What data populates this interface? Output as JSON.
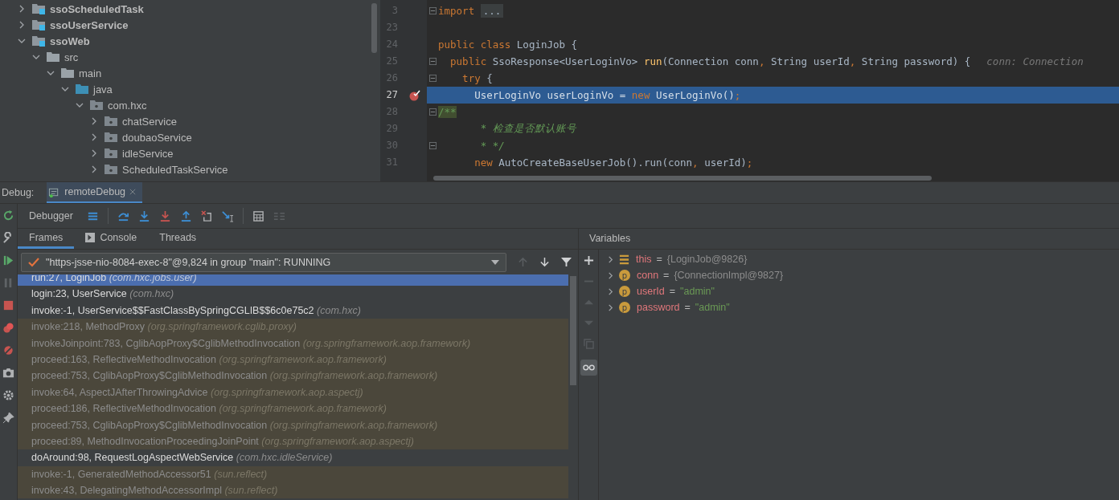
{
  "project_tree": [
    {
      "label": "ssoScheduledTask",
      "kind": "module",
      "expanded": false
    },
    {
      "label": "ssoUserService",
      "kind": "module",
      "expanded": false
    },
    {
      "label": "ssoWeb",
      "kind": "module",
      "expanded": true,
      "children": [
        {
          "label": "src",
          "kind": "folder",
          "expanded": true,
          "children": [
            {
              "label": "main",
              "kind": "folder",
              "expanded": true,
              "children": [
                {
                  "label": "java",
                  "kind": "source",
                  "expanded": true,
                  "children": [
                    {
                      "label": "com.hxc",
                      "kind": "package",
                      "expanded": true,
                      "children": [
                        {
                          "label": "chatService",
                          "kind": "package",
                          "expanded": false
                        },
                        {
                          "label": "doubaoService",
                          "kind": "package",
                          "expanded": false
                        },
                        {
                          "label": "idleService",
                          "kind": "package",
                          "expanded": false
                        },
                        {
                          "label": "ScheduledTaskService",
                          "kind": "package",
                          "expanded": false
                        }
                      ]
                    }
                  ]
                }
              ]
            }
          ]
        }
      ]
    }
  ],
  "editor": {
    "lines": [
      {
        "number": "3",
        "selected": false,
        "breakpoint": false,
        "fold": true,
        "tokens": [
          {
            "kind": "kw",
            "s": "import "
          },
          {
            "kind": "folded",
            "s": "..."
          }
        ]
      },
      {
        "number": "23",
        "selected": false,
        "breakpoint": false,
        "fold": false
      },
      {
        "number": "24",
        "selected": false,
        "breakpoint": false,
        "fold": false,
        "tokens": [
          {
            "kind": "kw",
            "s": "public class "
          },
          {
            "kind": "plain",
            "s": "LoginJob {"
          }
        ]
      },
      {
        "number": "25",
        "selected": false,
        "breakpoint": false,
        "fold": true,
        "tokens": [
          {
            "kind": "kw",
            "s": "  public "
          },
          {
            "kind": "plain",
            "s": "SsoResponse<UserLoginVo> "
          },
          {
            "kind": "method",
            "s": "run"
          },
          {
            "kind": "plain",
            "s": "(Connection conn"
          },
          {
            "kind": "kw",
            "s": ", "
          },
          {
            "kind": "plain",
            "s": "String userId"
          },
          {
            "kind": "kw",
            "s": ", "
          },
          {
            "kind": "plain",
            "s": "String password) {"
          },
          {
            "kind": "hint",
            "s": "conn: Connection"
          }
        ]
      },
      {
        "number": "26",
        "selected": false,
        "breakpoint": false,
        "fold": true,
        "tokens": [
          {
            "kind": "kw",
            "s": "    try "
          },
          {
            "kind": "plain",
            "s": "{"
          }
        ]
      },
      {
        "number": "27",
        "selected": true,
        "breakpoint": true,
        "fold": false,
        "tokens": [
          {
            "kind": "plain",
            "s": "      UserLoginVo userLoginVo = "
          },
          {
            "kind": "kw",
            "s": "new "
          },
          {
            "kind": "plain",
            "s": "UserLoginVo()"
          },
          {
            "kind": "kw",
            "s": ";"
          }
        ]
      },
      {
        "number": "28",
        "selected": false,
        "breakpoint": false,
        "fold": true,
        "tokens": [
          {
            "kind": "doc-open",
            "s": "/**"
          }
        ]
      },
      {
        "number": "29",
        "selected": false,
        "breakpoint": false,
        "fold": false,
        "tokens": [
          {
            "kind": "doc",
            "s": "       * 检查是否默认账号"
          }
        ]
      },
      {
        "number": "30",
        "selected": false,
        "breakpoint": false,
        "fold": true,
        "tokens": [
          {
            "kind": "doc",
            "s": "       * */"
          }
        ]
      },
      {
        "number": "31",
        "selected": false,
        "breakpoint": false,
        "fold": false,
        "tokens": [
          {
            "kind": "kw",
            "s": "      new "
          },
          {
            "kind": "plain",
            "s": "AutoCreateBaseUserJob().run(conn"
          },
          {
            "kind": "kw",
            "s": ", "
          },
          {
            "kind": "plain",
            "s": "userId)"
          },
          {
            "kind": "kw",
            "s": ";"
          }
        ]
      }
    ]
  },
  "debug": {
    "label": "Debug:",
    "session_tab": "remoteDebug",
    "toolbar_label": "Debugger",
    "tabs": [
      {
        "label": "Frames",
        "selected": true
      },
      {
        "label": "Console",
        "selected": false
      },
      {
        "label": "Threads",
        "selected": false
      }
    ],
    "thread": "\"https-jsse-nio-8084-exec-8\"@9,824 in group \"main\": RUNNING",
    "frames": [
      {
        "method": "run:27, LoginJob",
        "package": "(com.hxc.jobs.user)",
        "kind": "app",
        "selected": true
      },
      {
        "method": "login:23, UserService",
        "package": "(com.hxc)",
        "kind": "app",
        "selected": false
      },
      {
        "method": "invoke:-1, UserService$$FastClassBySpringCGLIB$$6c0e75c2",
        "package": "(com.hxc)",
        "kind": "app",
        "selected": false
      },
      {
        "method": "invoke:218, MethodProxy",
        "package": "(org.springframework.cglib.proxy)",
        "kind": "library",
        "selected": false
      },
      {
        "method": "invokeJoinpoint:783, CglibAopProxy$CglibMethodInvocation",
        "package": "(org.springframework.aop.framework)",
        "kind": "library",
        "selected": false
      },
      {
        "method": "proceed:163, ReflectiveMethodInvocation",
        "package": "(org.springframework.aop.framework)",
        "kind": "library",
        "selected": false
      },
      {
        "method": "proceed:753, CglibAopProxy$CglibMethodInvocation",
        "package": "(org.springframework.aop.framework)",
        "kind": "library",
        "selected": false
      },
      {
        "method": "invoke:64, AspectJAfterThrowingAdvice",
        "package": "(org.springframework.aop.aspectj)",
        "kind": "library",
        "selected": false
      },
      {
        "method": "proceed:186, ReflectiveMethodInvocation",
        "package": "(org.springframework.aop.framework)",
        "kind": "library",
        "selected": false
      },
      {
        "method": "proceed:753, CglibAopProxy$CglibMethodInvocation",
        "package": "(org.springframework.aop.framework)",
        "kind": "library",
        "selected": false
      },
      {
        "method": "proceed:89, MethodInvocationProceedingJoinPoint",
        "package": "(org.springframework.aop.aspectj)",
        "kind": "library",
        "selected": false
      },
      {
        "method": "doAround:98, RequestLogAspectWebService",
        "package": "(com.hxc.idleService)",
        "kind": "app",
        "selected": false
      },
      {
        "method": "invoke:-1, GeneratedMethodAccessor51",
        "package": "(sun.reflect)",
        "kind": "library",
        "selected": false
      },
      {
        "method": "invoke:43, DelegatingMethodAccessorImpl",
        "package": "(sun.reflect)",
        "kind": "library",
        "selected": false
      }
    ],
    "variables_title": "Variables",
    "variables": [
      {
        "name": "this",
        "operator": "=",
        "value": "{LoginJob@9826}",
        "kind": "field",
        "value_is_string": false
      },
      {
        "name": "conn",
        "operator": "=",
        "value": "{ConnectionImpl@9827}",
        "kind": "param",
        "badge": "p",
        "value_is_string": false
      },
      {
        "name": "userId",
        "operator": "=",
        "value": "\"admin\"",
        "kind": "param",
        "badge": "p",
        "value_is_string": true
      },
      {
        "name": "password",
        "operator": "=",
        "value": "\"admin\"",
        "kind": "param",
        "badge": "p",
        "value_is_string": true
      }
    ]
  }
}
